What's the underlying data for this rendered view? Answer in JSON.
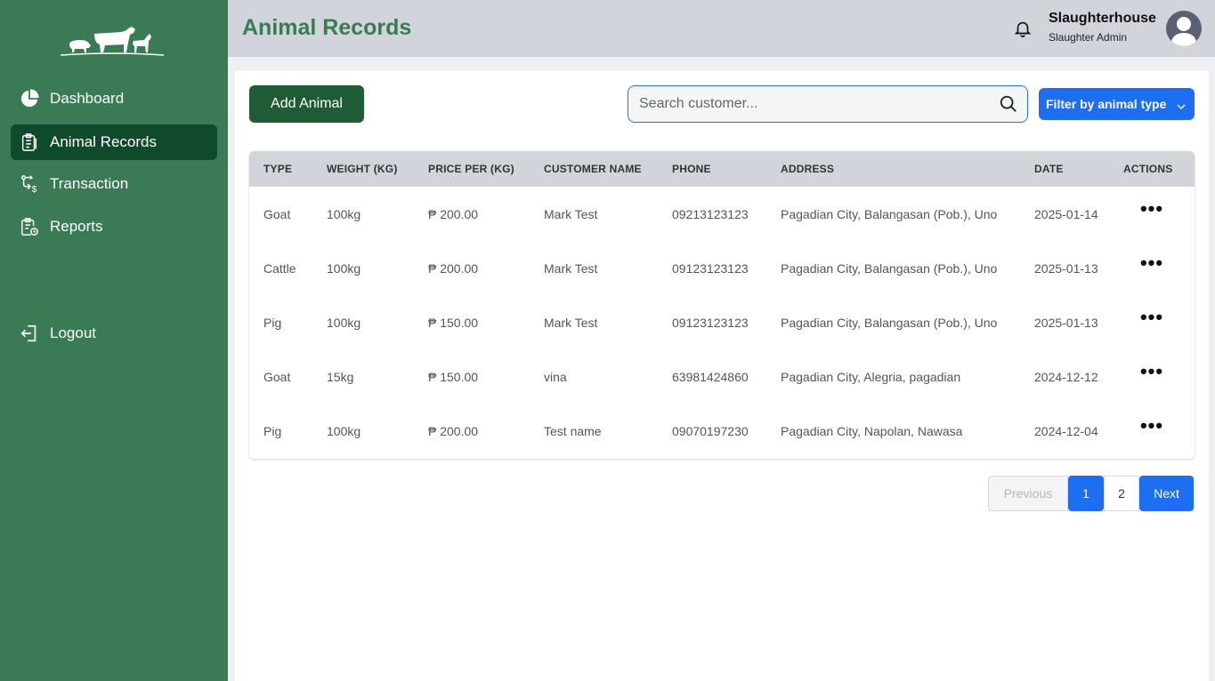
{
  "sidebar": {
    "logo_icon": "livestock-logo-icon",
    "items": [
      {
        "label": "Dashboard",
        "icon": "pie-chart-icon",
        "active": false
      },
      {
        "label": "Animal Records",
        "icon": "clipboard-icon",
        "active": true
      },
      {
        "label": "Transaction",
        "icon": "transaction-icon",
        "active": false
      },
      {
        "label": "Reports",
        "icon": "report-icon",
        "active": false
      }
    ],
    "logout_label": "Logout"
  },
  "header": {
    "title": "Animal Records",
    "user_name": "Slaughterhouse",
    "user_role": "Slaughter Admin"
  },
  "toolbar": {
    "add_label": "Add Animal",
    "search_placeholder": "Search customer...",
    "filter_label": "Filter by animal type"
  },
  "table": {
    "columns": [
      "TYPE",
      "WEIGHT (KG)",
      "PRICE PER (KG)",
      "CUSTOMER NAME",
      "PHONE",
      "ADDRESS",
      "DATE",
      "ACTIONS"
    ],
    "rows": [
      {
        "type": "Goat",
        "weight": "100kg",
        "price": "₱ 200.00",
        "customer": "Mark Test",
        "phone": "09213123123",
        "address": "Pagadian City, Balangasan (Pob.), Uno",
        "date": "2025-01-14",
        "actions": "•••"
      },
      {
        "type": "Cattle",
        "weight": "100kg",
        "price": "₱ 200.00",
        "customer": "Mark Test",
        "phone": "09123123123",
        "address": "Pagadian City, Balangasan (Pob.), Uno",
        "date": "2025-01-13",
        "actions": "•••"
      },
      {
        "type": "Pig",
        "weight": "100kg",
        "price": "₱ 150.00",
        "customer": "Mark Test",
        "phone": "09123123123",
        "address": "Pagadian City, Balangasan (Pob.), Uno",
        "date": "2025-01-13",
        "actions": "•••"
      },
      {
        "type": "Goat",
        "weight": "15kg",
        "price": "₱ 150.00",
        "customer": "vina",
        "phone": "63981424860",
        "address": "Pagadian City, Alegria, pagadian",
        "date": "2024-12-12",
        "actions": "•••"
      },
      {
        "type": "Pig",
        "weight": "100kg",
        "price": "₱ 200.00",
        "customer": "Test name",
        "phone": "09070197230",
        "address": "Pagadian City, Napolan, Nawasa",
        "date": "2024-12-04",
        "actions": "•••"
      }
    ]
  },
  "pagination": {
    "previous_label": "Previous",
    "pages": [
      "1",
      "2"
    ],
    "current_page": "1",
    "next_label": "Next"
  },
  "colors": {
    "sidebar_bg": "#3a7a55",
    "sidebar_active": "#0f4a2c",
    "title_green": "#3a7a55",
    "add_button": "#1f5b34",
    "accent_blue": "#1d6ef0",
    "topbar_bg": "#d1d5db"
  }
}
